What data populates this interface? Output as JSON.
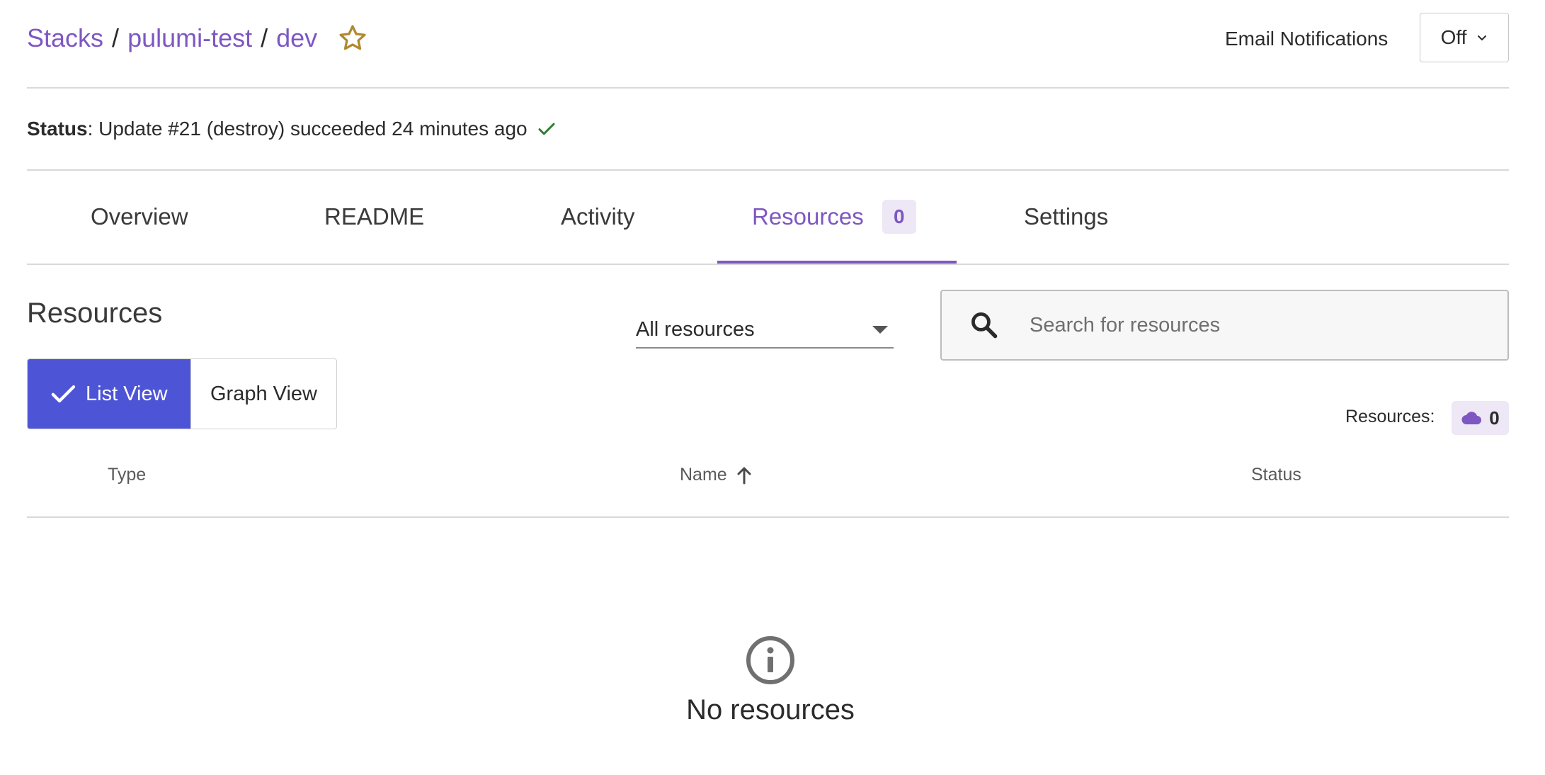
{
  "breadcrumb": {
    "stacks": "Stacks",
    "sep1": "/",
    "project": "pulumi-test",
    "sep2": "/",
    "stack": "dev"
  },
  "header": {
    "email_label": "Email Notifications",
    "email_value": "Off"
  },
  "status": {
    "label": "Status",
    "text": ": Update #21 (destroy) succeeded 24 minutes ago"
  },
  "tabs": [
    {
      "label": "Overview"
    },
    {
      "label": "README"
    },
    {
      "label": "Activity"
    },
    {
      "label": "Resources",
      "badge": "0"
    },
    {
      "label": "Settings"
    }
  ],
  "active_tab": "Resources",
  "resources": {
    "title": "Resources",
    "filter_value": "All resources",
    "search_placeholder": "Search for resources",
    "list_view_label": "List View",
    "graph_view_label": "Graph View",
    "count_label": "Resources:",
    "count_value": "0"
  },
  "table": {
    "columns": [
      "Type",
      "Name",
      "Status"
    ],
    "sorted_by": "Name"
  },
  "empty_state": {
    "text": "No resources"
  },
  "colors": {
    "accent": "#7e57c2",
    "primary_button": "#4d55d6",
    "success": "#2e7d32",
    "star": "#b08a2e"
  }
}
